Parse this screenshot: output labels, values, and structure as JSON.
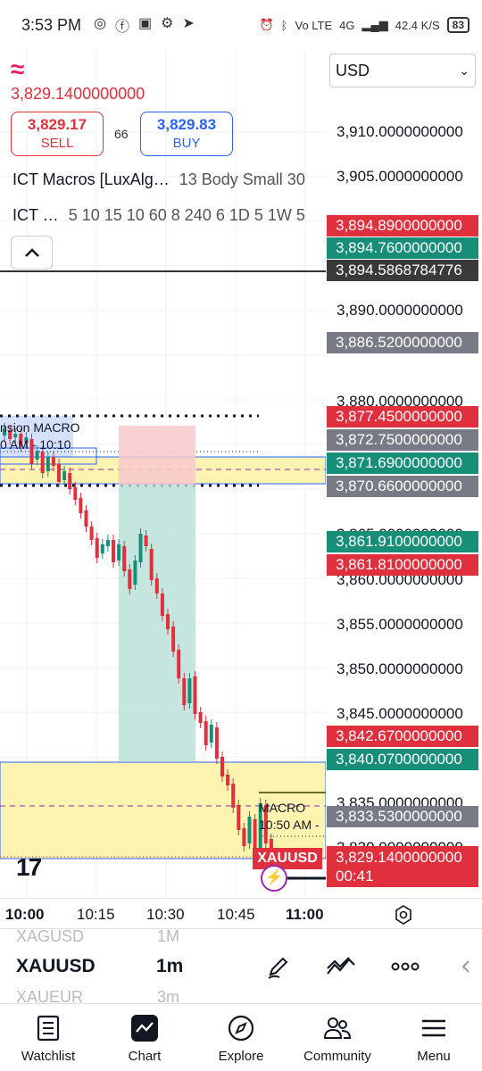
{
  "status_bar": {
    "time": "3:53 PM",
    "net_speed": "42.4",
    "net_unit": "K/S",
    "network": "4G",
    "volte": "Vo LTE",
    "battery": "83"
  },
  "chart_header": {
    "last_price": "3,829.1400000000",
    "sell_price": "3,829.17",
    "sell_label": "SELL",
    "spread": "66",
    "buy_price": "3,829.83",
    "buy_label": "BUY",
    "indicator1_name": "ICT Macros [LuxAlg…",
    "indicator1_params": "13 Body Small 30",
    "indicator2_name": "ICT …",
    "indicator2_params": "5 10 15 10 60 8 240 6 1D 5 1W 5"
  },
  "currency_select": {
    "value": "USD"
  },
  "price_scale": {
    "labels": [
      "3,910.0000000000",
      "3,905.0000000000",
      "3,890.0000000000",
      "3,880.0000000000",
      "3,865.0000000000",
      "3,860.0000000000",
      "3,855.0000000000",
      "3,850.0000000000",
      "3,845.0000000000",
      "3,835.0000000000",
      "3,830.0000000000"
    ],
    "tags": [
      {
        "text": "3,894.8900000000",
        "color": "#e0303e"
      },
      {
        "text": "3,894.7600000000",
        "color": "#178f78"
      },
      {
        "text": "3,894.5868784776",
        "color": "#3a3a3a"
      },
      {
        "text": "3,886.5200000000",
        "color": "#787b86"
      },
      {
        "text": "3,877.4500000000",
        "color": "#e0303e"
      },
      {
        "text": "3,872.7500000000",
        "color": "#787b86"
      },
      {
        "text": "3,871.6900000000",
        "color": "#178f78"
      },
      {
        "text": "3,870.6600000000",
        "color": "#787b86"
      },
      {
        "text": "3,861.9100000000",
        "color": "#178f78"
      },
      {
        "text": "3,861.8100000000",
        "color": "#e0303e"
      },
      {
        "text": "3,842.6700000000",
        "color": "#e0303e"
      },
      {
        "text": "3,840.0700000000",
        "color": "#178f78"
      },
      {
        "text": "3,833.5300000000",
        "color": "#787b86"
      }
    ],
    "current_price": "3,829.1400000000",
    "countdown": "00:41"
  },
  "chart": {
    "symbol_flag": "XAUUSD",
    "macro_label_top": "nsion MACRO",
    "macro_time_top": "0 AM - 10:10",
    "macro_label_bottom": "MACRO",
    "macro_time_bottom": "10:50 AM -"
  },
  "time_axis": {
    "labels": [
      "10:00",
      "10:15",
      "10:30",
      "10:45",
      "11:00"
    ]
  },
  "symbol_picker": {
    "prev_symbol": "XAGUSD",
    "prev_interval": "1M",
    "symbol": "XAUUSD",
    "interval": "1m",
    "next_symbol": "XAUEUR",
    "next_interval": "3m"
  },
  "bottom_nav": {
    "items": [
      {
        "label": "Watchlist",
        "icon": "watchlist-icon"
      },
      {
        "label": "Chart",
        "icon": "chart-icon"
      },
      {
        "label": "Explore",
        "icon": "compass-icon"
      },
      {
        "label": "Community",
        "icon": "community-icon"
      },
      {
        "label": "Menu",
        "icon": "menu-icon"
      }
    ]
  },
  "colors": {
    "up": "#178f78",
    "down": "#e0303e",
    "accent": "#2962ff",
    "macro_zone": "#fff3b0"
  }
}
